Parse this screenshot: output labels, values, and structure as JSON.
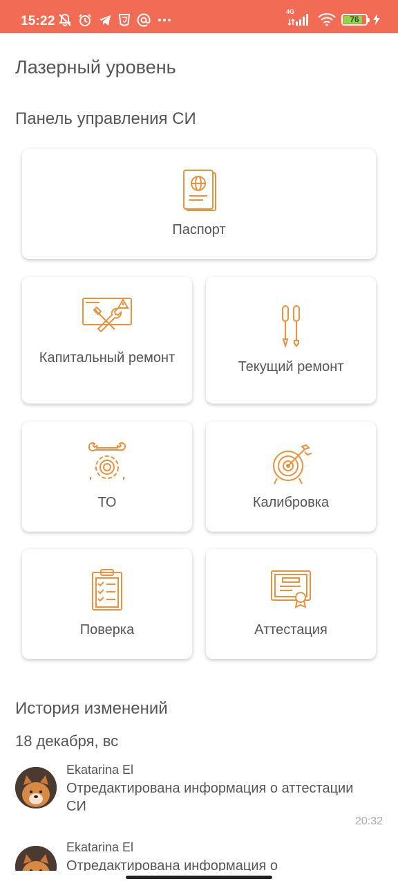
{
  "status_bar": {
    "time": "15:22",
    "network": "4G",
    "battery": "76",
    "background": "#f26b54"
  },
  "page_title": "Лазерный уровень",
  "panel": {
    "title": "Панель управления СИ",
    "accent": "#e8913f",
    "cards": [
      {
        "label": "Паспорт",
        "icon": "passport-icon"
      },
      {
        "label": "Капитальный ремонт",
        "icon": "repair-tools-icon"
      },
      {
        "label": "Текущий ремонт",
        "icon": "screwdrivers-icon"
      },
      {
        "label": "ТО",
        "icon": "wrench-gear-icon"
      },
      {
        "label": "Калибровка",
        "icon": "target-icon"
      },
      {
        "label": "Поверка",
        "icon": "checklist-icon"
      },
      {
        "label": "Аттестация",
        "icon": "certificate-icon"
      }
    ]
  },
  "history": {
    "title": "История изменений",
    "date": "18 декабря, вс",
    "items": [
      {
        "author": "Ekatarina El",
        "text": "Отредактирована информация о аттестации СИ",
        "time": "20:32"
      },
      {
        "author": "Ekatarina El",
        "text": "Отредактирована информация о"
      }
    ]
  }
}
